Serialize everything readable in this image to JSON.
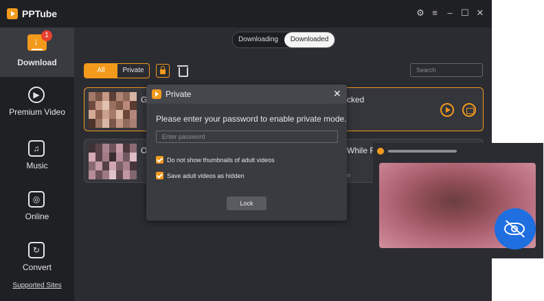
{
  "app": {
    "title": "PPTube",
    "controls": {
      "settings": "⚙",
      "menu": "≡",
      "minimize": "–",
      "maximize": "☐",
      "close": "✕"
    }
  },
  "sidebar": {
    "items": [
      {
        "label": "Download",
        "icon": "download-icon",
        "badge": "1",
        "active": true
      },
      {
        "label": "Premium Video",
        "icon": "play-circle-icon"
      },
      {
        "label": "Music",
        "icon": "music-note-icon"
      },
      {
        "label": "Online",
        "icon": "globe-icon"
      },
      {
        "label": "Convert",
        "icon": "convert-icon"
      }
    ],
    "supported_sites": "Supported Sites"
  },
  "tabs": {
    "downloading": "Downloading",
    "downloaded": "Downloaded",
    "active": "Downloaded"
  },
  "filters": {
    "all": "All",
    "private": "Private"
  },
  "search": {
    "placeholder": "Search"
  },
  "rows": [
    {
      "title_start": "G",
      "title_end": "cked"
    },
    {
      "title_start": "O",
      "title_end": "While R",
      "subtitle_end": "o"
    }
  ],
  "modal": {
    "title": "Private",
    "close": "✕",
    "prompt": "Please enter your password to enable private mode.",
    "password_placeholder": "Enter password",
    "options": [
      {
        "label": "Do not show thumbnails of adult videos",
        "checked": true
      },
      {
        "label": "Save adult videos as hidden",
        "checked": true
      }
    ],
    "lock_label": "Lock"
  },
  "colors": {
    "accent": "#f39a1c",
    "sidebar": "#1f2024",
    "panel": "#2b2c31",
    "eye_badge": "#1f6fe0"
  }
}
